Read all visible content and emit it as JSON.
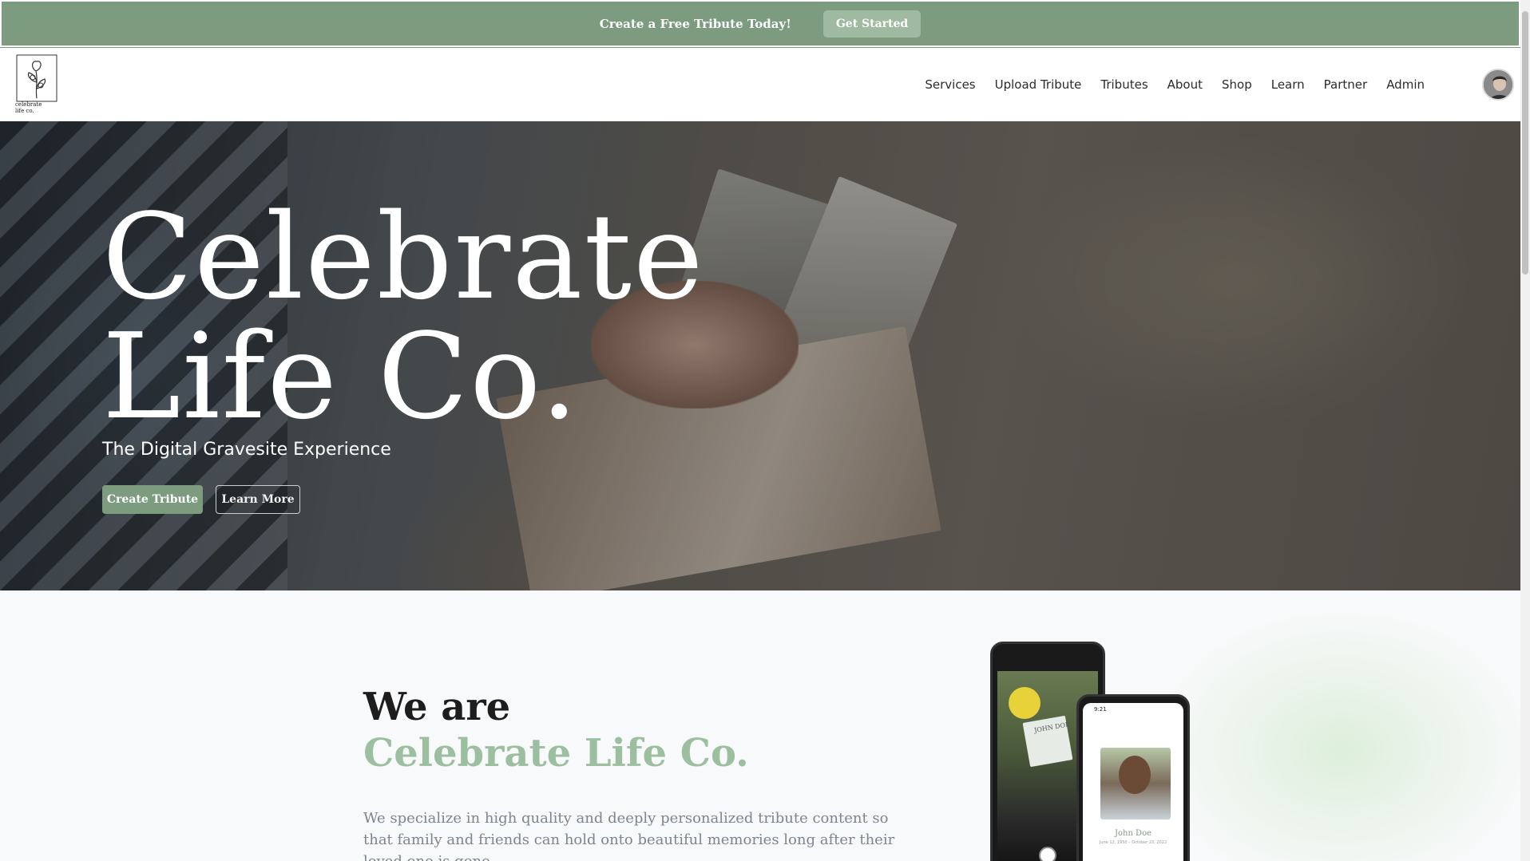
{
  "promo": {
    "text": "Create a Free Tribute Today!",
    "button": "Get Started"
  },
  "logo": {
    "line1": "celebrate",
    "line2": "life co."
  },
  "nav": {
    "items": [
      {
        "label": "Services"
      },
      {
        "label": "Upload Tribute"
      },
      {
        "label": "Tributes"
      },
      {
        "label": "About"
      },
      {
        "label": "Shop"
      },
      {
        "label": "Learn"
      },
      {
        "label": "Partner"
      },
      {
        "label": "Admin"
      }
    ]
  },
  "hero": {
    "title_line1": "Celebrate",
    "title_line2": "Life Co.",
    "subtitle": "The Digital Gravesite Experience",
    "primary_button": "Create Tribute",
    "secondary_button": "Learn More"
  },
  "about": {
    "heading": "We are",
    "brand": "Celebrate Life Co.",
    "description": "We specialize in high quality and deeply personalized tribute content so that family and friends can hold onto beautiful memories long after their loved one is gone."
  },
  "mockup": {
    "card_name": "JOHN DOE",
    "phone_time": "9:21",
    "profile_name": "John Doe",
    "profile_dates": "June 12, 1950 – October 23, 2022"
  },
  "colors": {
    "brand_green": "#7d9c7f",
    "brand_light_green": "#9cbf9f"
  }
}
